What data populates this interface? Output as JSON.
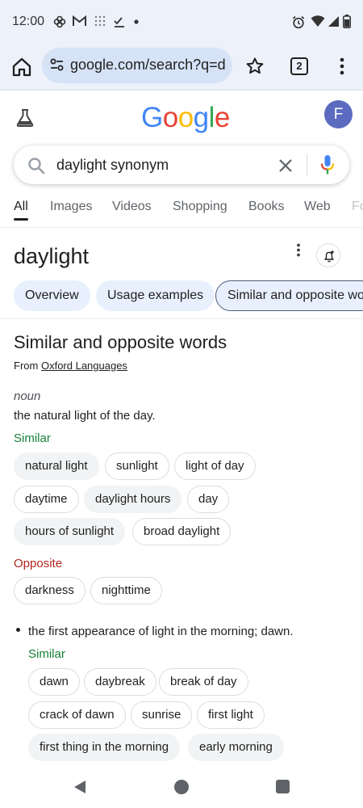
{
  "status_bar": {
    "time": "12:00"
  },
  "browser": {
    "url": "google.com/search?q=d",
    "tab_count": "2"
  },
  "google": {
    "logo_letters": [
      {
        "ch": "G",
        "color": "#4285F4"
      },
      {
        "ch": "o",
        "color": "#EA4335"
      },
      {
        "ch": "o",
        "color": "#FBBC05"
      },
      {
        "ch": "g",
        "color": "#4285F4"
      },
      {
        "ch": "l",
        "color": "#34A853"
      },
      {
        "ch": "e",
        "color": "#EA4335"
      }
    ],
    "avatar_letter": "F"
  },
  "search": {
    "query": "daylight synonym"
  },
  "tabs": [
    "All",
    "Images",
    "Videos",
    "Shopping",
    "Books",
    "Web",
    "Fo"
  ],
  "knowledge": {
    "title": "daylight",
    "pills": [
      "Overview",
      "Usage examples",
      "Similar and opposite wo"
    ]
  },
  "dictionary": {
    "section_title": "Similar and opposite words",
    "from_prefix": "From",
    "source": "Oxford Languages",
    "part_of_speech": "noun",
    "sense1": {
      "definition": "the natural light of the day.",
      "similar_label": "Similar",
      "similar": [
        "natural light",
        "sunlight",
        "light of day",
        "daytime",
        "daylight hours",
        "day",
        "hours of sunlight",
        "broad daylight"
      ],
      "opposite_label": "Opposite",
      "opposite": [
        "darkness",
        "nighttime"
      ]
    },
    "sense2": {
      "definition": "the first appearance of light in the morning; dawn.",
      "similar_label": "Similar",
      "similar": [
        "dawn",
        "daybreak",
        "break of day",
        "crack of dawn",
        "sunrise",
        "first light",
        "first thing in the morning",
        "early morning"
      ]
    }
  },
  "colors": {
    "similar": "#188038",
    "opposite": "#b3261e",
    "pill_bg": "#e8f0fe"
  }
}
